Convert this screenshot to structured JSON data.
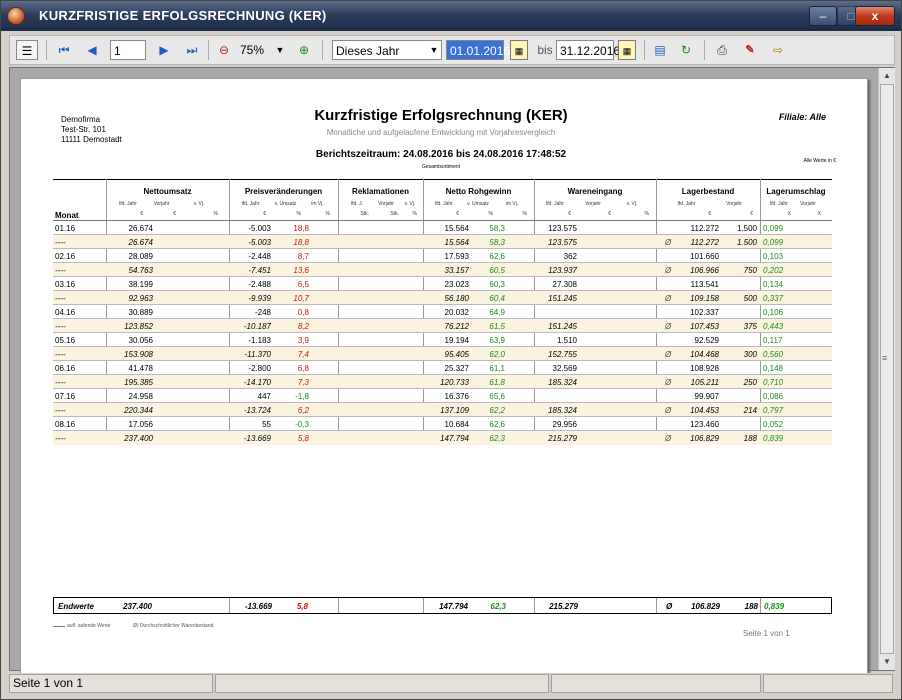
{
  "window": {
    "title": "KURZFRISTIGE ERFOLGSRECHNUNG (KER)",
    "min": "–",
    "max": "□",
    "close": "x"
  },
  "toolbar": {
    "page_value": "1",
    "zoom": "75%",
    "period": "Dieses Jahr",
    "from": "01.01.2016",
    "bis": "bis",
    "to": "31.12.2016"
  },
  "report": {
    "company": [
      "Demofirma",
      "Test-Str. 101",
      "11111 Demostadt"
    ],
    "title": "Kurzfristige Erfolgsrechnung (KER)",
    "subtitle": "Monatliche und aufgelaufene Entwicklung mit Vorjahresvergleich",
    "branch": "Filiale: Alle",
    "period": "Berichtszeitraum: 24.08.2016 bis 24.08.2016 17:48:52",
    "assortment": "Gesamtsortiment",
    "all_values": "Alle Werte in €",
    "month_header": "Monat",
    "groups": [
      {
        "label": "Nettoumsatz",
        "subs": [
          "lfd. Jahr",
          "Vorjahr",
          "v. Vj."
        ],
        "units": [
          "€",
          "€",
          "%"
        ]
      },
      {
        "label": "Preisveränderungen",
        "subs": [
          "lfd. Jahr",
          "v. Umsatz",
          "im Vj."
        ],
        "units": [
          "€",
          "%",
          "%"
        ]
      },
      {
        "label": "Reklamationen",
        "subs": [
          "lfd. J.",
          "Vorjahr",
          "v. Vj."
        ],
        "units": [
          "Stk.",
          "Stk.",
          "%"
        ]
      },
      {
        "label": "Netto Rohgewinn",
        "subs": [
          "lfd. Jahr",
          "v. Umsatz",
          "im Vj."
        ],
        "units": [
          "€",
          "%",
          "%"
        ]
      },
      {
        "label": "Wareneingang",
        "subs": [
          "lfd. Jahr",
          "Vorjahr",
          "v. Vj."
        ],
        "units": [
          "€",
          "€",
          "%"
        ]
      },
      {
        "label": "Lagerbestand",
        "subs": [
          "lfd. Jahr",
          "Vorjahr"
        ],
        "units": [
          "€",
          "€"
        ]
      },
      {
        "label": "Lagerumschlag",
        "subs": [
          "lfd. Jahr",
          "Vorjahr"
        ],
        "units": [
          "X",
          "X"
        ]
      }
    ],
    "rows": [
      {
        "m": "01.16",
        "cum": false,
        "nu": "26.674",
        "pv": "-5.003",
        "pvp": "18,8",
        "nr": "15.564",
        "nrp": "58,3",
        "we": "123.575",
        "dia": "",
        "lb": "112.272",
        "lbv": "1.500",
        "lu": "0,099"
      },
      {
        "m": "----",
        "cum": true,
        "nu": "26.674",
        "pv": "-5.003",
        "pvp": "18,8",
        "nr": "15.564",
        "nrp": "58,3",
        "we": "123.575",
        "dia": "Ø",
        "lb": "112.272",
        "lbv": "1.500",
        "lu": "0,099"
      },
      {
        "m": "02.16",
        "cum": false,
        "nu": "28.089",
        "pv": "-2.448",
        "pvp": "8,7",
        "nr": "17.593",
        "nrp": "62,6",
        "we": "362",
        "dia": "",
        "lb": "101.660",
        "lbv": "",
        "lu": "0,103"
      },
      {
        "m": "----",
        "cum": true,
        "nu": "54.763",
        "pv": "-7.451",
        "pvp": "13,6",
        "nr": "33.157",
        "nrp": "60,5",
        "we": "123.937",
        "dia": "Ø",
        "lb": "106.966",
        "lbv": "750",
        "lu": "0,202"
      },
      {
        "m": "03.16",
        "cum": false,
        "nu": "38.199",
        "pv": "-2.488",
        "pvp": "6,5",
        "nr": "23.023",
        "nrp": "60,3",
        "we": "27.308",
        "dia": "",
        "lb": "113.541",
        "lbv": "",
        "lu": "0,134"
      },
      {
        "m": "----",
        "cum": true,
        "nu": "92.963",
        "pv": "-9.939",
        "pvp": "10,7",
        "nr": "56.180",
        "nrp": "60,4",
        "we": "151.245",
        "dia": "Ø",
        "lb": "109.158",
        "lbv": "500",
        "lu": "0,337"
      },
      {
        "m": "04.16",
        "cum": false,
        "nu": "30.889",
        "pv": "-248",
        "pvp": "0,8",
        "nr": "20.032",
        "nrp": "64,9",
        "we": "",
        "dia": "",
        "lb": "102.337",
        "lbv": "",
        "lu": "0,106"
      },
      {
        "m": "----",
        "cum": true,
        "nu": "123.852",
        "pv": "-10.187",
        "pvp": "8,2",
        "nr": "76.212",
        "nrp": "61,5",
        "we": "151.245",
        "dia": "Ø",
        "lb": "107.453",
        "lbv": "375",
        "lu": "0,443"
      },
      {
        "m": "05.16",
        "cum": false,
        "nu": "30.056",
        "pv": "-1.183",
        "pvp": "3,9",
        "nr": "19.194",
        "nrp": "63,9",
        "we": "1.510",
        "dia": "",
        "lb": "92.529",
        "lbv": "",
        "lu": "0,117"
      },
      {
        "m": "----",
        "cum": true,
        "nu": "153.908",
        "pv": "-11.370",
        "pvp": "7,4",
        "nr": "95.405",
        "nrp": "62,0",
        "we": "152.755",
        "dia": "Ø",
        "lb": "104.468",
        "lbv": "300",
        "lu": "0,560"
      },
      {
        "m": "06.16",
        "cum": false,
        "nu": "41.478",
        "pv": "-2.800",
        "pvp": "6,8",
        "nr": "25.327",
        "nrp": "61,1",
        "we": "32.569",
        "dia": "",
        "lb": "108.928",
        "lbv": "",
        "lu": "0,148"
      },
      {
        "m": "----",
        "cum": true,
        "nu": "195.385",
        "pv": "-14.170",
        "pvp": "7,3",
        "nr": "120.733",
        "nrp": "61,8",
        "we": "185.324",
        "dia": "Ø",
        "lb": "105.211",
        "lbv": "250",
        "lu": "0,710"
      },
      {
        "m": "07.16",
        "cum": false,
        "nu": "24.958",
        "pv": "447",
        "pvp": "-1,8",
        "nr": "16.376",
        "nrp": "65,6",
        "we": "",
        "dia": "",
        "lb": "99.907",
        "lbv": "",
        "lu": "0,086"
      },
      {
        "m": "----",
        "cum": true,
        "nu": "220.344",
        "pv": "-13.724",
        "pvp": "6,2",
        "nr": "137.109",
        "nrp": "62,2",
        "we": "185.324",
        "dia": "Ø",
        "lb": "104.453",
        "lbv": "214",
        "lu": "0,797"
      },
      {
        "m": "08.16",
        "cum": false,
        "nu": "17.056",
        "pv": "55",
        "pvp": "-0,3",
        "nr": "10.684",
        "nrp": "62,6",
        "we": "29.956",
        "dia": "",
        "lb": "123.460",
        "lbv": "",
        "lu": "0,052"
      },
      {
        "m": "----",
        "cum": true,
        "nu": "237.400",
        "pv": "-13.669",
        "pvp": "5,8",
        "nr": "147.794",
        "nrp": "62,3",
        "we": "215.279",
        "dia": "Ø",
        "lb": "106.829",
        "lbv": "188",
        "lu": "0,839"
      }
    ],
    "end": {
      "label": "Endwerte",
      "nu": "237.400",
      "pv": "-13.669",
      "pvp": "5,8",
      "nr": "147.794",
      "nrp": "62,3",
      "we": "215.279",
      "dia": "Ø",
      "lb": "106.829",
      "lbv": "188",
      "lu": "0,839"
    },
    "legend_cum": "aufl. aufende Werte",
    "legend_avg": "Ø) Durchschnittlicher Warenbestand",
    "page_footer": "Seite 1  von 1"
  },
  "status": {
    "page": "Seite 1 von 1"
  },
  "colors": {
    "negative_pct": "#d01010",
    "positive_pct": "#1a8a1a",
    "cum_row": "#faf3df",
    "titlebar": "#2c3d5e"
  }
}
